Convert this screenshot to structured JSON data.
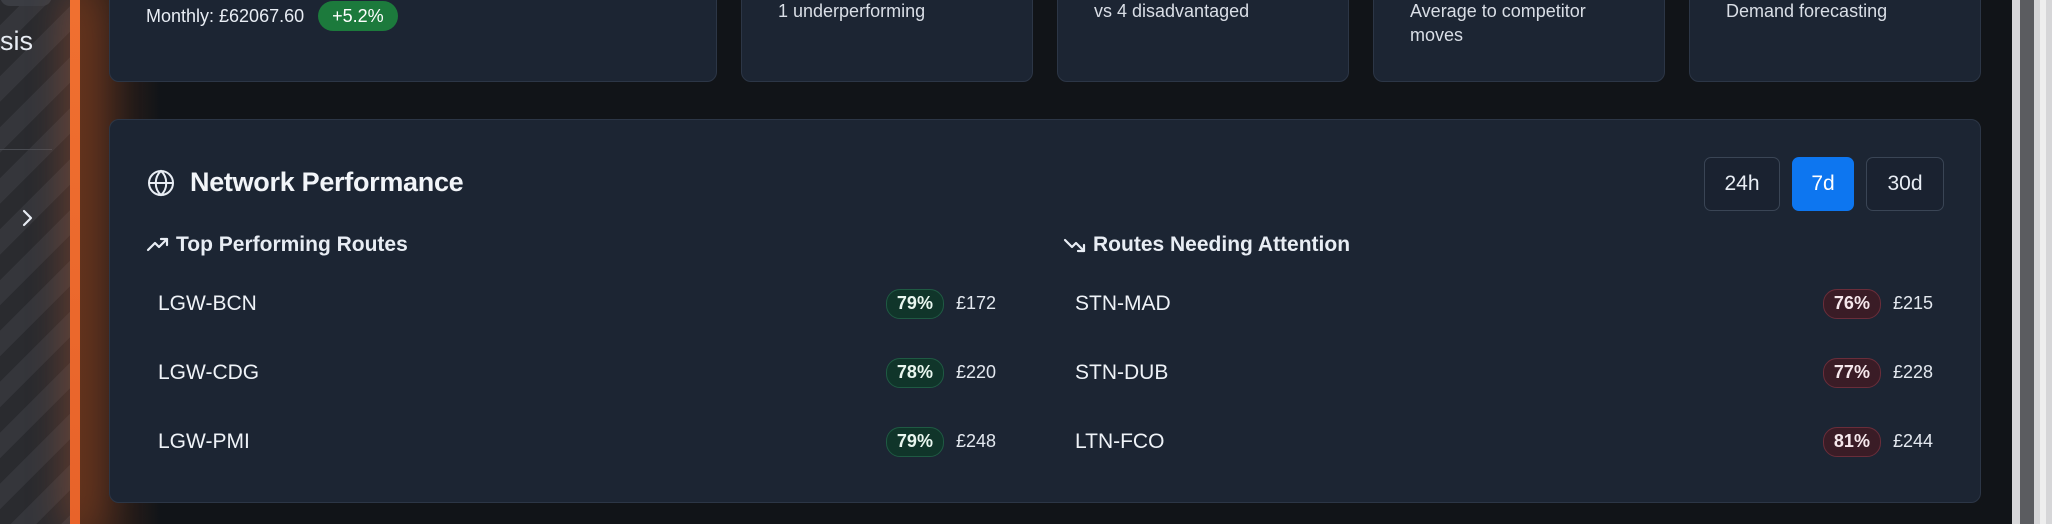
{
  "sidebar": {
    "partial_text": "sis"
  },
  "top_cards": {
    "monthly_label": "Monthly: £62067.60",
    "monthly_delta": "+5.2%",
    "card2_text": "1 underperforming",
    "card3_text": "vs 4 disadvantaged",
    "card4_text": "Average to competitor moves",
    "card5_text": "Demand forecasting"
  },
  "network": {
    "title": "Network Performance",
    "ranges": [
      "24h",
      "7d",
      "30d"
    ],
    "selected_range": "7d",
    "top_routes_title": "Top Performing Routes",
    "attention_routes_title": "Routes Needing Attention",
    "top_routes": [
      {
        "route": "LGW-BCN",
        "pct": "79%",
        "price": "£172"
      },
      {
        "route": "LGW-CDG",
        "pct": "78%",
        "price": "£220"
      },
      {
        "route": "LGW-PMI",
        "pct": "79%",
        "price": "£248"
      }
    ],
    "attention_routes": [
      {
        "route": "STN-MAD",
        "pct": "76%",
        "price": "£215"
      },
      {
        "route": "STN-DUB",
        "pct": "77%",
        "price": "£228"
      },
      {
        "route": "LTN-FCO",
        "pct": "81%",
        "price": "£244"
      }
    ]
  },
  "colors": {
    "accent_orange": "#e8632a",
    "selected_blue": "#0d76f0",
    "positive_green": "#1c7a3c",
    "panel_bg": "#1c2533"
  }
}
